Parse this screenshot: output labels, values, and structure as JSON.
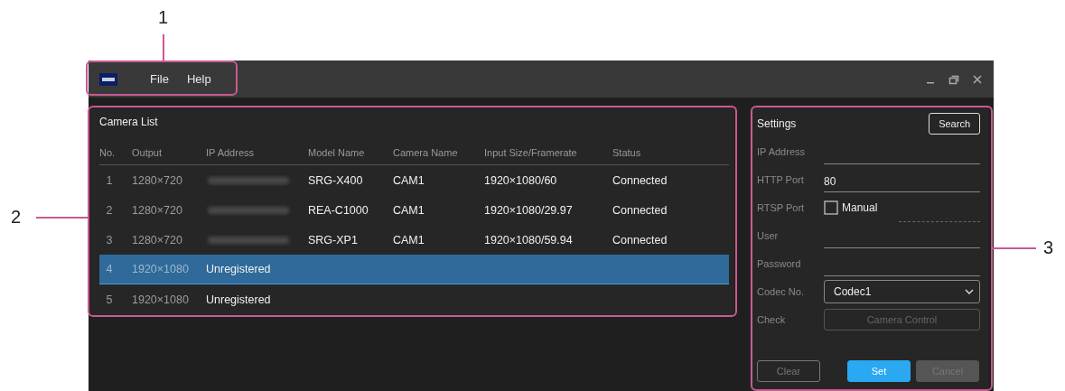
{
  "callouts": [
    {
      "label": "1"
    },
    {
      "label": "2"
    },
    {
      "label": "3"
    }
  ],
  "menu": [
    {
      "label": "File"
    },
    {
      "label": "Help"
    }
  ],
  "camera_list": {
    "title": "Camera List",
    "columns": [
      "No.",
      "Output",
      "IP Address",
      "Model Name",
      "Camera Name",
      "Input Size/Framerate",
      "Status"
    ],
    "rows": [
      {
        "kind": "camera",
        "selected": false,
        "no": "1",
        "output": "1280×720",
        "model": "SRG-X400",
        "camera": "CAM1",
        "input": "1920×1080/60",
        "status": "Connected"
      },
      {
        "kind": "camera",
        "selected": false,
        "no": "2",
        "output": "1280×720",
        "model": "REA-C1000",
        "camera": "CAM1",
        "input": "1920×1080/29.97",
        "status": "Connected"
      },
      {
        "kind": "camera",
        "selected": false,
        "no": "3",
        "output": "1280×720",
        "model": "SRG-XP1",
        "camera": "CAM1",
        "input": "1920×1080/59.94",
        "status": "Connected"
      },
      {
        "kind": "unregistered",
        "selected": true,
        "no": "4",
        "output": "1920×1080",
        "status": "Unregistered"
      },
      {
        "kind": "unregistered",
        "selected": false,
        "no": "5",
        "output": "1920×1080",
        "status": "Unregistered"
      }
    ]
  },
  "settings": {
    "title": "Settings",
    "search_button": "Search",
    "fields": [
      {
        "kind": "text",
        "label": "IP Address"
      },
      {
        "kind": "text",
        "label": "HTTP Port",
        "value": "80"
      },
      {
        "kind": "checkbox",
        "label": "RTSP Port",
        "option": "Manual",
        "checked": false
      },
      {
        "kind": "text",
        "label": "User"
      },
      {
        "kind": "text",
        "label": "Password"
      },
      {
        "kind": "select",
        "label": "Codec No.",
        "value": "Codec1"
      },
      {
        "kind": "button",
        "label": "Check",
        "button": "Camera Control",
        "disabled": true
      }
    ],
    "buttons": [
      {
        "kind": "outline",
        "label": "Clear",
        "disabled": true
      },
      {
        "kind": "primary",
        "label": "Set",
        "disabled": false
      },
      {
        "kind": "filled",
        "label": "Cancel",
        "disabled": true
      }
    ]
  }
}
